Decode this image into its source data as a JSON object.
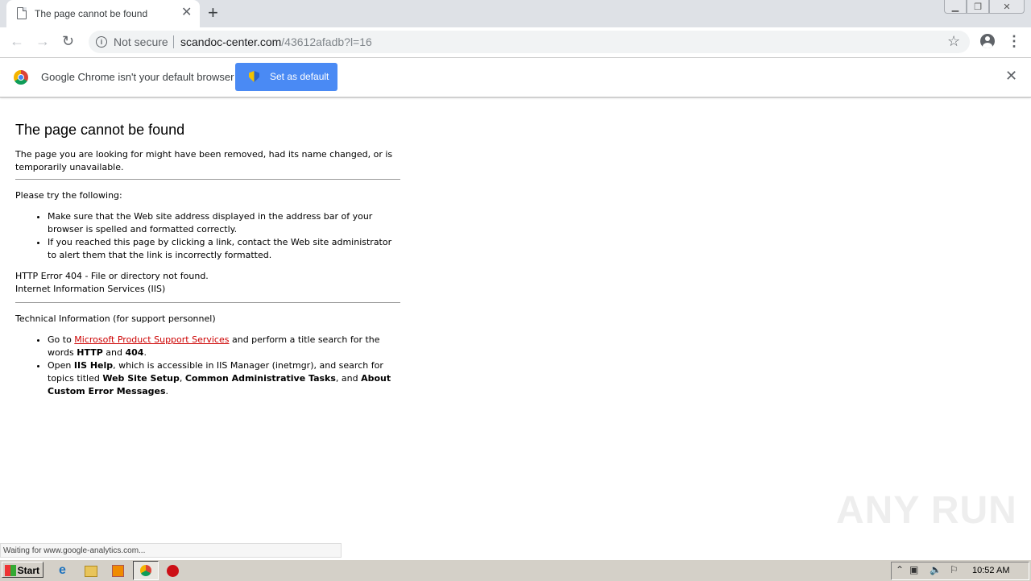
{
  "browser": {
    "tab": {
      "title": "The page cannot be found"
    },
    "address": {
      "security": "Not secure",
      "host": "scandoc-center.com",
      "path": "/43612afadb?l=16"
    },
    "infobar": {
      "message": "Google Chrome isn't your default browser",
      "button": "Set as default"
    },
    "status": "Waiting for www.google-analytics.com..."
  },
  "page": {
    "heading": "The page cannot be found",
    "intro": "The page you are looking for might have been removed, had its name changed, or is temporarily unavailable.",
    "try_heading": "Please try the following:",
    "try_items": [
      "Make sure that the Web site address displayed in the address bar of your browser is spelled and formatted correctly.",
      "If you reached this page by clicking a link, contact the Web site administrator to alert them that the link is incorrectly formatted."
    ],
    "error_line": "HTTP Error 404 - File or directory not found.",
    "server_line": "Internet Information Services (IIS)",
    "tech_heading": "Technical Information (for support personnel)",
    "tech1": {
      "pre": "Go to ",
      "link": "Microsoft Product Support Services",
      "mid": " and perform a title search for the words ",
      "b1": "HTTP",
      "and": " and ",
      "b2": "404",
      "end": "."
    },
    "tech2": {
      "pre": "Open ",
      "b1": "IIS Help",
      "mid": ", which is accessible in IIS Manager (inetmgr), and search for topics titled ",
      "b2": "Web Site Setup",
      "comma": ", ",
      "b3": "Common Administrative Tasks",
      "and": ", and ",
      "b4": "About Custom Error Messages",
      "end": "."
    }
  },
  "taskbar": {
    "start": "Start",
    "clock": "10:52 AM"
  },
  "watermark": "ANY RUN",
  "colors": {
    "link": "#cc0000",
    "button": "#4a8af4"
  }
}
